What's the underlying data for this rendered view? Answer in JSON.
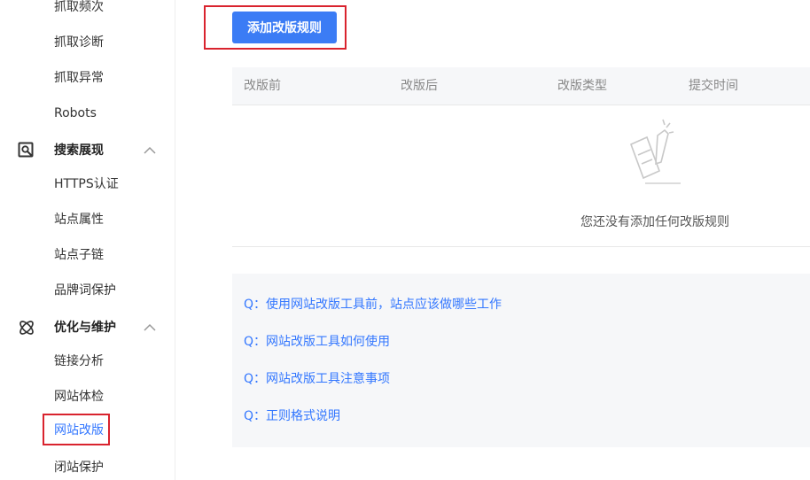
{
  "sidebar": {
    "items_top": [
      "抓取频次",
      "抓取诊断",
      "抓取异常",
      "Robots"
    ],
    "section_search": "搜索展现",
    "items_search": [
      "HTTPS认证",
      "站点属性",
      "站点子链",
      "品牌词保护"
    ],
    "section_optimize": "优化与维护",
    "items_optimize": [
      "链接分析",
      "网站体检",
      "网站改版",
      "闭站保护"
    ]
  },
  "main": {
    "add_button": "添加改版规则",
    "table_headers": [
      "改版前",
      "改版后",
      "改版类型",
      "提交时间"
    ],
    "empty_text": "您还没有添加任何改版规则",
    "faq": [
      "Q：使用网站改版工具前，站点应该做哪些工作",
      "Q：网站改版工具如何使用",
      "Q：网站改版工具注意事项",
      "Q：正则格式说明"
    ]
  },
  "colors": {
    "accent": "#3b7cf5",
    "link": "#3377ff",
    "highlight_border": "#d9232e"
  },
  "icons": {
    "search_section": "search-monitor-icon",
    "optimize_section": "atom-icon",
    "empty_state": "document-pen-icon",
    "collapse": "chevron-up-icon"
  }
}
